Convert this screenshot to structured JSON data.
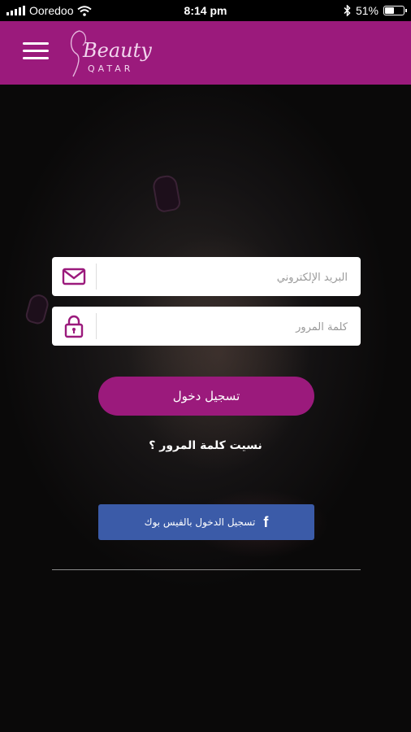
{
  "status_bar": {
    "carrier": "Ooredoo",
    "time": "8:14 pm",
    "battery_percent": "51%",
    "battery_level": 0.51,
    "icons": [
      "signal-icon",
      "wifi-icon",
      "bluetooth-icon",
      "battery-icon"
    ]
  },
  "header": {
    "brand_script": "Beauty",
    "brand_sub": "QATAR",
    "menu_icon": "hamburger-menu-icon",
    "background_color": "#9b1a7c"
  },
  "login_form": {
    "email_placeholder": "البريد الإلكتروني",
    "email_icon": "envelope-icon",
    "password_placeholder": "كلمة المرور",
    "password_icon": "lock-icon",
    "login_button_label": "تسجيل دخول",
    "forgot_password_label": "نسيت كلمة المرور ؟",
    "facebook_icon": "facebook-icon",
    "facebook_login_label": "تسجيل الدخول بالفيس بوك",
    "accent_color": "#9b1a7c",
    "facebook_color": "#3b5ba8"
  }
}
